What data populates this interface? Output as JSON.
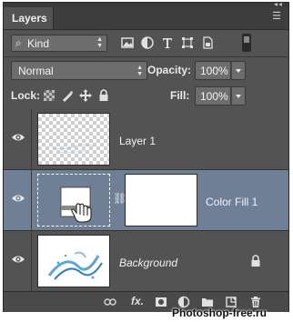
{
  "panel": {
    "tab_label": "Layers",
    "panel_menu_icon": "panel-menu-icon",
    "collapse_glyph": "◂◂"
  },
  "filter": {
    "kind_label": "Kind",
    "icons": [
      "pixel-layer-filter-icon",
      "adjustment-layer-filter-icon",
      "type-layer-filter-icon",
      "shape-layer-filter-icon",
      "smart-object-filter-icon"
    ]
  },
  "blend": {
    "mode": "Normal",
    "opacity_label": "Opacity:",
    "opacity_value": "100%",
    "fill_label": "Fill:",
    "fill_value": "100%"
  },
  "lock": {
    "label": "Lock:",
    "icons": [
      "lock-transparent-pixels-icon",
      "lock-image-pixels-icon",
      "lock-position-icon",
      "lock-all-icon"
    ]
  },
  "layers": [
    {
      "name": "Layer 1",
      "visible": true,
      "selected": false,
      "italic": false
    },
    {
      "name": "Color Fill 1",
      "visible": true,
      "selected": true,
      "italic": false
    },
    {
      "name": "Background",
      "visible": true,
      "selected": false,
      "italic": true,
      "locked": true
    }
  ],
  "bottom_icons": [
    "link-layers-icon",
    "fx-icon",
    "layer-mask-icon",
    "adjustment-layer-icon",
    "new-group-icon",
    "new-layer-icon",
    "trash-icon"
  ],
  "bottom_fx_label": "fx.",
  "watermark": "Photoshop-free.ru",
  "colors": {
    "panel": "#535353",
    "selected_row": "#6f7f96",
    "field": "#6d6d6d"
  }
}
